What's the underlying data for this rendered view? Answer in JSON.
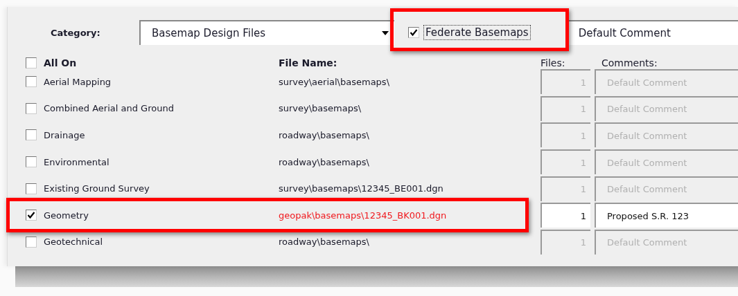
{
  "category": {
    "label": "Category:",
    "value": "Basemap Design Files"
  },
  "federate": {
    "label": "Federate Basemaps",
    "checked": true,
    "highlighted": true
  },
  "default_comment": {
    "value": "Default Comment"
  },
  "all_on": {
    "label": "All On",
    "checked": false
  },
  "headers": {
    "file_name": "File Name:",
    "files": "Files:",
    "comments": "Comments:"
  },
  "rows": [
    {
      "label": "Aerial Mapping",
      "file": "survey\\aerial\\basemaps\\",
      "count": "1",
      "comment": "Default Comment",
      "checked": false,
      "highlighted": false
    },
    {
      "label": "Combined Aerial and Ground",
      "file": "survey\\basemaps\\",
      "count": "1",
      "comment": "Default Comment",
      "checked": false,
      "highlighted": false
    },
    {
      "label": "Drainage",
      "file": "roadway\\basemaps\\",
      "count": "1",
      "comment": "Default Comment",
      "checked": false,
      "highlighted": false
    },
    {
      "label": "Environmental",
      "file": "roadway\\basemaps\\",
      "count": "1",
      "comment": "Default Comment",
      "checked": false,
      "highlighted": false
    },
    {
      "label": "Existing Ground Survey",
      "file": "survey\\basemaps\\12345_BE001.dgn",
      "count": "1",
      "comment": "Default Comment",
      "checked": false,
      "highlighted": false
    },
    {
      "label": "Geometry",
      "file": "geopak\\basemaps\\12345_BK001.dgn",
      "count": "1",
      "comment": "Proposed S.R. 123",
      "checked": true,
      "highlighted": true
    },
    {
      "label": "Geotechnical",
      "file": "roadway\\basemaps\\",
      "count": "1",
      "comment": "Default Comment",
      "checked": false,
      "highlighted": false
    }
  ]
}
